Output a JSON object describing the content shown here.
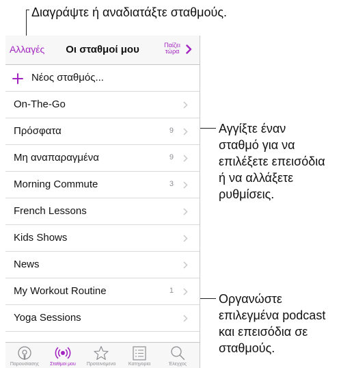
{
  "annotations": {
    "edit_stations": "Διαγράψτε ή αναδιατάξτε σταθμούς.",
    "tap_station": [
      "Αγγίξτε έναν",
      "σταθμό για να",
      "επιλέξετε επεισόδια",
      "ή να αλλάξετε",
      "ρυθμίσεις."
    ],
    "organize": [
      "Οργανώστε",
      "επιλεγμένα podcast",
      "και επεισόδια σε",
      "σταθμούς."
    ]
  },
  "navbar": {
    "edit_label": "Αλλαγές",
    "title": "Οι σταθμοί μου",
    "now_playing_line1": "Παίζει",
    "now_playing_line2": "τώρα"
  },
  "new_station_label": "Νέος σταθμός...",
  "stations": [
    {
      "label": "On-The-Go",
      "count": ""
    },
    {
      "label": "Πρόσφατα",
      "count": "9"
    },
    {
      "label": "Μη αναπαραγμένα",
      "count": "9"
    },
    {
      "label": "Morning Commute",
      "count": "3"
    },
    {
      "label": "French Lessons",
      "count": ""
    },
    {
      "label": "Kids Shows",
      "count": ""
    },
    {
      "label": "News",
      "count": ""
    },
    {
      "label": "My Workout Routine",
      "count": "1"
    },
    {
      "label": "Yoga Sessions",
      "count": ""
    }
  ],
  "tabs": [
    {
      "label": "Παρουσίασης",
      "icon": "podcast-icon",
      "active": false
    },
    {
      "label": "Σταθμοί μου",
      "icon": "station-icon",
      "active": true
    },
    {
      "label": "Προτεινόμενα",
      "icon": "star-icon",
      "active": false
    },
    {
      "label": "Κατηγορία",
      "icon": "list-icon",
      "active": false
    },
    {
      "label": "Έλεγχος",
      "icon": "search-icon",
      "active": false
    }
  ],
  "colors": {
    "accent": "#a224c0",
    "chevron": "#c7c7cc",
    "tab_inactive": "#8e8e93"
  }
}
